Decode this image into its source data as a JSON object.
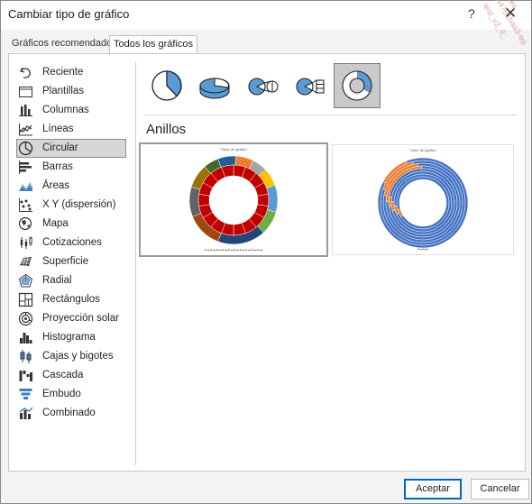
{
  "window": {
    "title": "Cambiar tipo de gráfico",
    "help_glyph": "?",
    "close_glyph": "✕"
  },
  "tabs": [
    {
      "label": "Gráficos recomendados",
      "selected": false
    },
    {
      "label": "Todos los gráficos",
      "selected": true
    }
  ],
  "sidebar": {
    "selected": "Circular",
    "items": [
      {
        "label": "Reciente",
        "icon": "undo-arrow-icon"
      },
      {
        "label": "Plantillas",
        "icon": "folder-icon"
      },
      {
        "label": "Columnas",
        "icon": "column-chart-icon"
      },
      {
        "label": "Líneas",
        "icon": "line-chart-icon"
      },
      {
        "label": "Circular",
        "icon": "pie-chart-icon"
      },
      {
        "label": "Barras",
        "icon": "bar-chart-icon"
      },
      {
        "label": "Áreas",
        "icon": "area-chart-icon"
      },
      {
        "label": "X Y (dispersión)",
        "icon": "scatter-chart-icon"
      },
      {
        "label": "Mapa",
        "icon": "map-chart-icon"
      },
      {
        "label": "Cotizaciones",
        "icon": "stock-chart-icon"
      },
      {
        "label": "Superficie",
        "icon": "surface-chart-icon"
      },
      {
        "label": "Radial",
        "icon": "radar-chart-icon"
      },
      {
        "label": "Rectángulos",
        "icon": "treemap-chart-icon"
      },
      {
        "label": "Proyección solar",
        "icon": "sunburst-chart-icon"
      },
      {
        "label": "Histograma",
        "icon": "histogram-chart-icon"
      },
      {
        "label": "Cajas y bigotes",
        "icon": "box-whisker-chart-icon"
      },
      {
        "label": "Cascada",
        "icon": "waterfall-chart-icon"
      },
      {
        "label": "Embudo",
        "icon": "funnel-chart-icon"
      },
      {
        "label": "Combinado",
        "icon": "combo-chart-icon"
      }
    ]
  },
  "subtypes": [
    {
      "icon": "pie-icon",
      "selected": false
    },
    {
      "icon": "pie-3d-icon",
      "selected": false
    },
    {
      "icon": "pie-of-pie-icon",
      "selected": false
    },
    {
      "icon": "bar-of-pie-icon",
      "selected": false
    },
    {
      "icon": "doughnut-icon",
      "selected": true
    }
  ],
  "section_title": "Anillos",
  "previews": [
    {
      "title": "Título del gráfico",
      "selected": true
    },
    {
      "title": "Título del gráfico",
      "selected": false
    }
  ],
  "buttons": {
    "ok": "Aceptar",
    "cancel": "Cancelar"
  },
  "watermark": [
    "tes",
    "h4761baa3-e",
    "test_v2_8_",
    "r8"
  ],
  "colors": {
    "accent": "#0067c0",
    "chart_blue": "#5b9bd5",
    "chart_orange": "#ed7d31",
    "chart_red": "#c00000"
  }
}
